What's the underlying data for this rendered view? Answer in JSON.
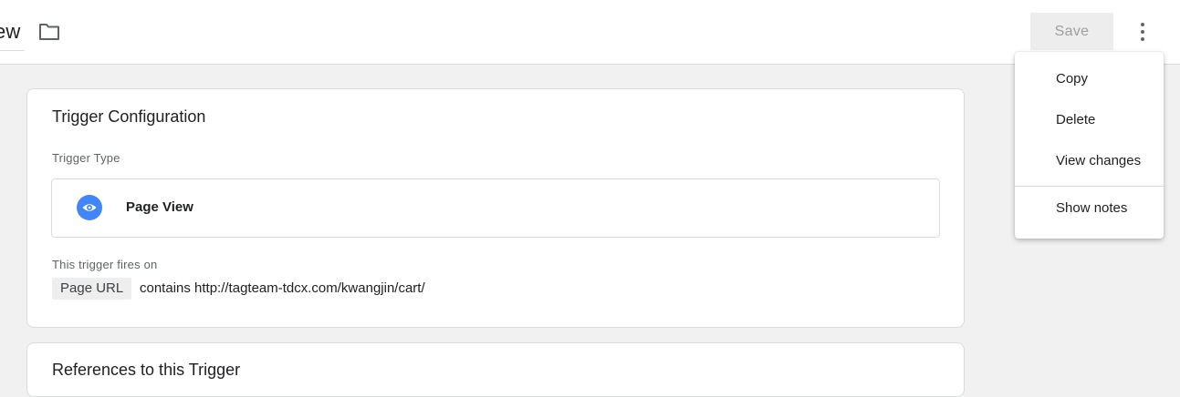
{
  "header": {
    "title_fragment": "ew",
    "save_label": "Save",
    "icons": {
      "folder": "folder-icon",
      "more": "more-vert-icon"
    }
  },
  "trigger_config": {
    "title": "Trigger Configuration",
    "type_label": "Trigger Type",
    "type_name": "Page View",
    "type_icon": "eye-icon",
    "type_icon_color": "#4285f4",
    "fires_label": "This trigger fires on",
    "condition": {
      "variable": "Page URL",
      "text": "contains http://tagteam-tdcx.com/kwangjin/cart/"
    }
  },
  "references": {
    "title": "References to this Trigger"
  },
  "menu": {
    "items": [
      "Copy",
      "Delete",
      "View changes",
      "Show notes"
    ]
  }
}
